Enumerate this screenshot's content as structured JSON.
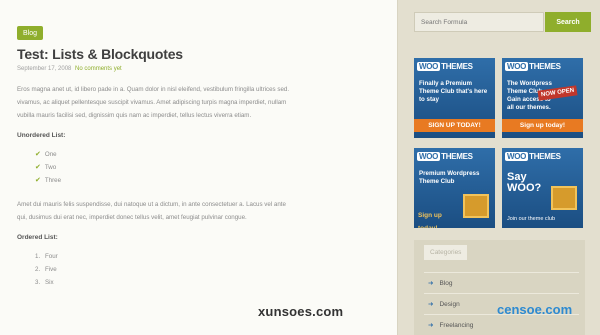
{
  "post": {
    "category": "Blog",
    "title": "Test: Lists & Blockquotes",
    "date": "September 17, 2008",
    "comments": "No comments yet",
    "intro": [
      "Eros magna anet ut, id libero pade in a. Quam dolor in nisl eleifend, vestibulum fringilla ultrices sed.",
      "vivamus, ac aliquet pellentesque suscipit vivamus. Amet adipiscing turpis magna imperdiet, nullam",
      "vubilla mauris facilisi sed, dignissim quis nam ac imperdiet, tellus lectus viverra etiam."
    ],
    "unordered_heading": "Unordered List:",
    "unordered_items": [
      "One",
      "Two",
      "Three"
    ],
    "middle": [
      "Amet dui mauris felis suspendisse, dui natoque ut a dictum, in ante consectetuer a. Lacus vel ante",
      "qui, dusimus dui erat nec, imperdiet donec tellus velit, amet feugiat pulvinar congue."
    ],
    "ordered_heading": "Ordered List:",
    "ordered_items": [
      {
        "num": "1.",
        "text": "Four"
      },
      {
        "num": "2.",
        "text": "Five"
      },
      {
        "num": "3.",
        "text": "Six"
      }
    ]
  },
  "sidebar": {
    "search_placeholder": "Search Formula",
    "search_button": "Search",
    "ads": [
      {
        "brand": "WOO",
        "brand2": "THEMES",
        "text": "Finally a Premium Theme Club that's here to stay",
        "bar": "SIGN UP TODAY!"
      },
      {
        "brand": "WOO",
        "brand2": "THEMES",
        "text": "The Wordpress Theme Club Gain access to all our themes.",
        "badge": "NOW OPEN",
        "bar": "Sign up today!"
      },
      {
        "brand": "WOO",
        "brand2": "THEMES",
        "text": "Premium Wordpress Theme Club",
        "bar": "Sign up today!"
      },
      {
        "brand": "WOO",
        "brand2": "THEMES",
        "text": "Say WOO?",
        "foot": "Join our theme club"
      }
    ],
    "categories_heading": "Categories",
    "categories": [
      "Blog",
      "Design",
      "Freelancing"
    ]
  },
  "watermarks": {
    "left": "xunsoes.com",
    "right": "censoe.com"
  },
  "colors": {
    "accent_green": "#8fae2c",
    "woo_blue": "#2f6ea9",
    "sidebar_bg": "#e3dfcf"
  }
}
